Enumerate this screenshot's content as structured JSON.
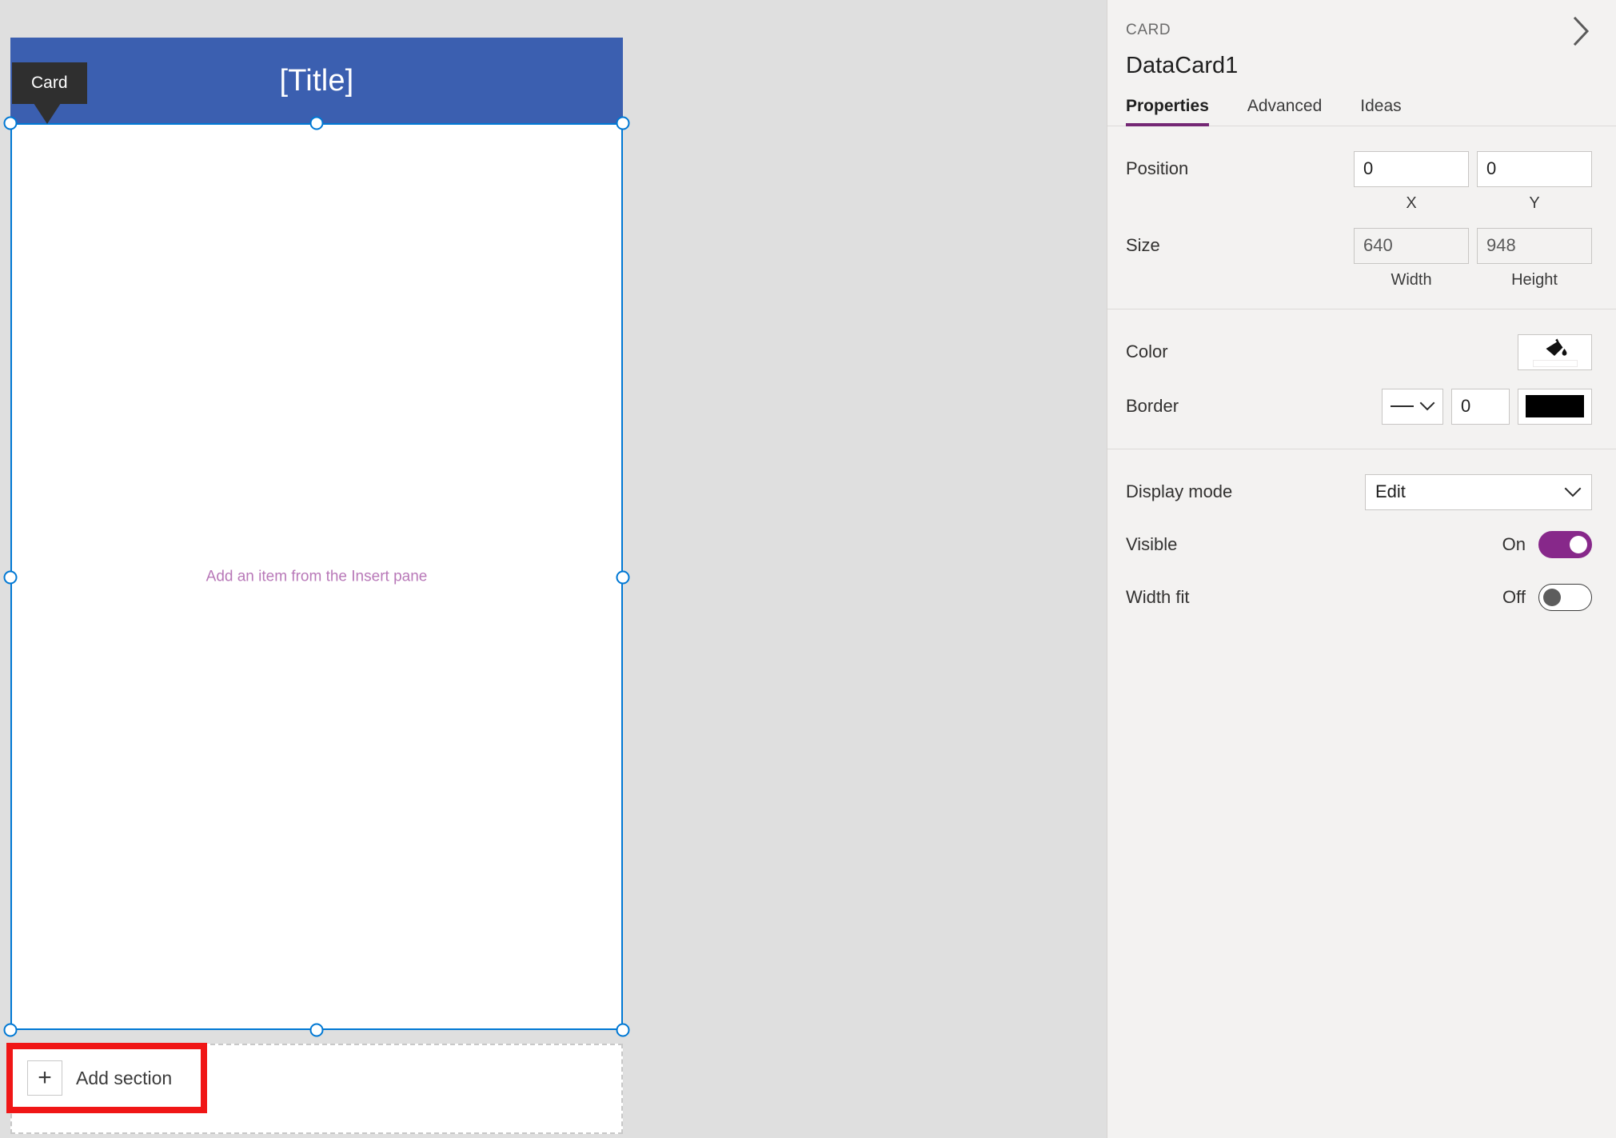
{
  "canvas": {
    "card_badge_label": "Card",
    "card_title": "[Title]",
    "card_placeholder": "Add an item from the Insert pane",
    "add_section_label": "Add section",
    "plus_icon_glyph": "+",
    "highlight_color": "#f01616",
    "header_color": "#3b5fb0",
    "selection_color": "#0078d4",
    "placeholder_color": "#b878b8"
  },
  "panel": {
    "kicker": "CARD",
    "title": "DataCard1",
    "collapse_icon": "chevron-right-icon",
    "tabs": [
      {
        "label": "Properties",
        "active": true
      },
      {
        "label": "Advanced",
        "active": false
      },
      {
        "label": "Ideas",
        "active": false
      }
    ],
    "position": {
      "label": "Position",
      "x_value": "0",
      "y_value": "0",
      "x_sublabel": "X",
      "y_sublabel": "Y"
    },
    "size": {
      "label": "Size",
      "width_value": "640",
      "height_value": "948",
      "width_sublabel": "Width",
      "height_sublabel": "Height"
    },
    "color": {
      "label": "Color",
      "icon": "paint-bucket-icon",
      "swatch_hex": "#ffffff"
    },
    "border": {
      "label": "Border",
      "style": "solid-line",
      "thickness_value": "0",
      "swatch_hex": "#000000"
    },
    "display_mode": {
      "label": "Display mode",
      "value": "Edit"
    },
    "visible": {
      "label": "Visible",
      "state": "On",
      "on": true
    },
    "width_fit": {
      "label": "Width fit",
      "state": "Off",
      "on": false
    },
    "accent_color": "#742774",
    "toggle_on_color": "#87288a"
  }
}
